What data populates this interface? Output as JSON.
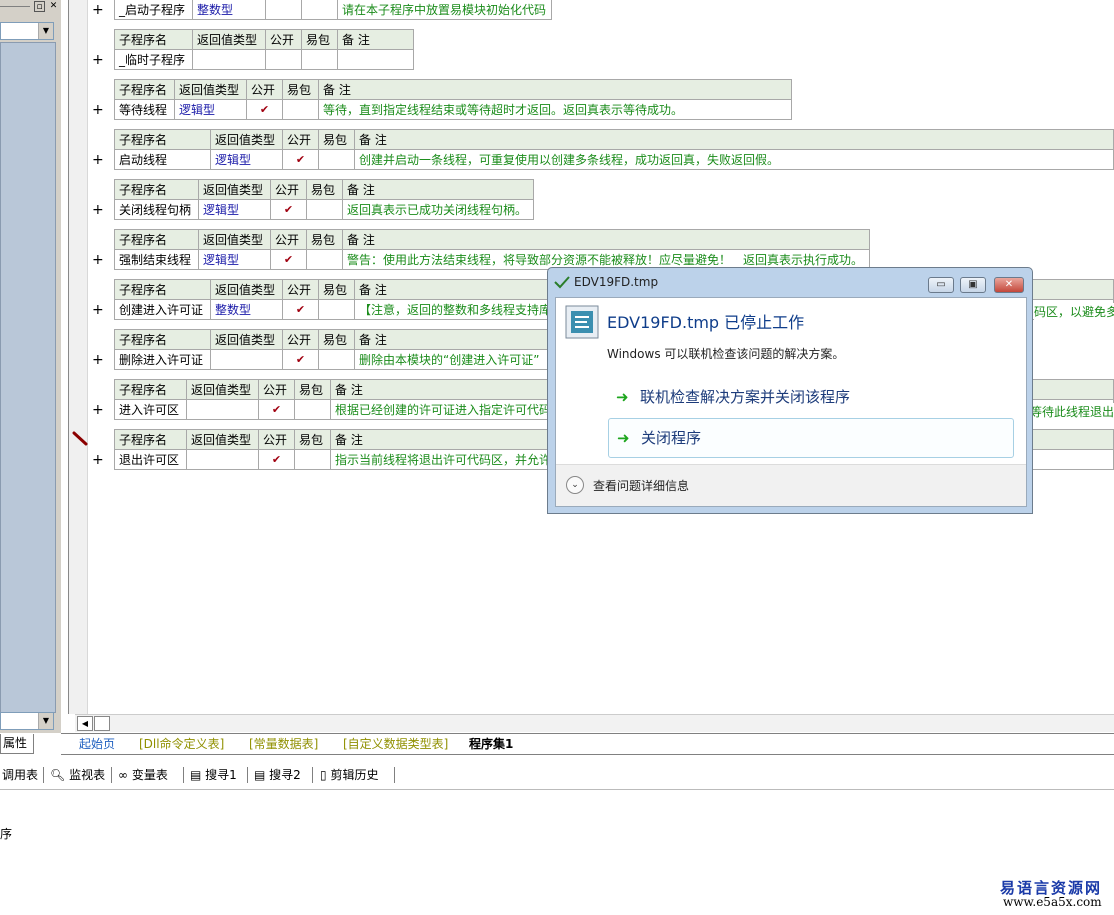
{
  "tables": [
    {
      "rows": [
        {
          "name": "_启动子程序",
          "ret": "整数型",
          "pub": "",
          "pkg": "",
          "note": "请在本子程序中放置易模块初始化代码"
        }
      ]
    },
    {
      "header": [
        "子程序名",
        "返回值类型",
        "公开",
        "易包",
        "备 注"
      ],
      "rows": [
        {
          "name": "_临时子程序",
          "ret": "",
          "pub": "",
          "pkg": "",
          "note": ""
        }
      ]
    },
    {
      "header": [
        "子程序名",
        "返回值类型",
        "公开",
        "易包",
        "备 注"
      ],
      "rows": [
        {
          "name": "等待线程",
          "ret": "逻辑型",
          "pub": "✔",
          "pkg": "",
          "note": "等待，直到指定线程结束或等待超时才返回。返回真表示等待成功。"
        }
      ]
    },
    {
      "header": [
        "子程序名",
        "返回值类型",
        "公开",
        "易包",
        "备 注"
      ],
      "rows": [
        {
          "name": "启动线程",
          "ret": "逻辑型",
          "pub": "✔",
          "pkg": "",
          "note": "创建并启动一条线程，可重复使用以创建多条线程，成功返回真，失败返回假。"
        }
      ]
    },
    {
      "header": [
        "子程序名",
        "返回值类型",
        "公开",
        "易包",
        "备 注"
      ],
      "rows": [
        {
          "name": "关闭线程句柄",
          "ret": "逻辑型",
          "pub": "✔",
          "pkg": "",
          "note": "返回真表示已成功关闭线程句柄。"
        }
      ]
    },
    {
      "header": [
        "子程序名",
        "返回值类型",
        "公开",
        "易包",
        "备 注"
      ],
      "rows": [
        {
          "name": "强制结束线程",
          "ret": "逻辑型",
          "pub": "✔",
          "pkg": "",
          "note": "警告：使用此方法结束线程，将导致部分资源不能被释放！应尽量避免！　返回真表示执行成功。"
        }
      ]
    },
    {
      "header": [
        "子程序名",
        "返回值类型",
        "公开",
        "易包",
        "备 注"
      ],
      "rows": [
        {
          "name": "创建进入许可证",
          "ret": "整数型",
          "pub": "✔",
          "pkg": "",
          "note": "【注意，返回的整数和多线程支持库",
          "note_tail": "码区，以避免多"
        }
      ]
    },
    {
      "header": [
        "子程序名",
        "返回值类型",
        "公开",
        "易包",
        "备 注"
      ],
      "rows": [
        {
          "name": "删除进入许可证",
          "ret": "",
          "pub": "✔",
          "pkg": "",
          "note": "删除由本模块的“创建进入许可证”"
        }
      ]
    },
    {
      "header": [
        "子程序名",
        "返回值类型",
        "公开",
        "易包",
        "备 注"
      ],
      "rows": [
        {
          "name": "进入许可区",
          "ret": "",
          "pub": "✔",
          "pkg": "",
          "note": "根据已经创建的许可证进入指定许可代码",
          "note_tail": "等待此线程退出"
        }
      ]
    },
    {
      "header": [
        "子程序名",
        "返回值类型",
        "公开",
        "易包",
        "备 注"
      ],
      "rows": [
        {
          "name": "退出许可区",
          "ret": "",
          "pub": "✔",
          "pkg": "",
          "note": "指示当前线程将退出许可代码区，并允许"
        }
      ]
    }
  ],
  "plus_sign": "+",
  "tabs": [
    "起始页",
    "[Dll命令定义表]",
    "[常量数据表]",
    "[自定义数据类型表]",
    "程序集1"
  ],
  "left_tab": "属性",
  "toolbar": [
    "调用表",
    "监视表",
    "变量表",
    "搜寻1",
    "搜寻2",
    "剪辑历史"
  ],
  "output_text": "序",
  "dialog": {
    "title": "EDV19FD.tmp",
    "heading": "EDV19FD.tmp 已停止工作",
    "subtitle": "Windows 可以联机检查该问题的解决方案。",
    "option1": "联机检查解决方案并关闭该程序",
    "option2": "关闭程序",
    "details": "查看问题详细信息"
  },
  "watermark": {
    "line1": "易语言资源网",
    "line2": "www.e5a5x.com"
  }
}
